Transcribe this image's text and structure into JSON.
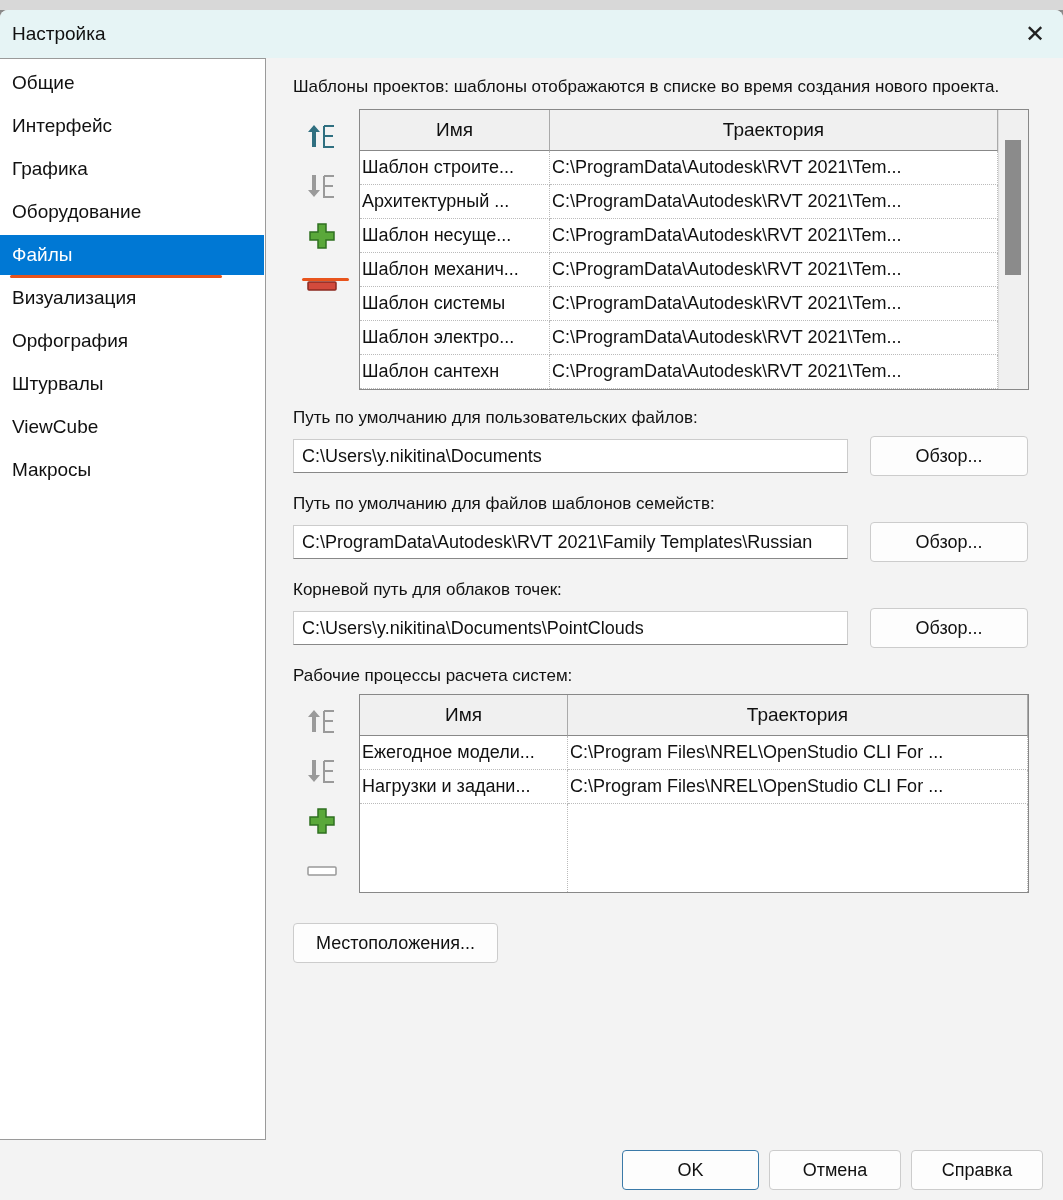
{
  "window": {
    "title": "Настройка",
    "close": "✕"
  },
  "sidebar": {
    "items": [
      {
        "label": "Общие",
        "selected": false
      },
      {
        "label": "Интерфейс",
        "selected": false
      },
      {
        "label": "Графика",
        "selected": false
      },
      {
        "label": "Оборудование",
        "selected": false
      },
      {
        "label": "Файлы",
        "selected": true
      },
      {
        "label": "Визуализация",
        "selected": false
      },
      {
        "label": "Орфография",
        "selected": false
      },
      {
        "label": "Штурвалы",
        "selected": false
      },
      {
        "label": "ViewCube",
        "selected": false
      },
      {
        "label": "Макросы",
        "selected": false
      }
    ]
  },
  "templates": {
    "description": "Шаблоны проектов: шаблоны отображаются в списке во время создания нового проекта.",
    "tools": [
      {
        "kind": "up",
        "disabled": false
      },
      {
        "kind": "down",
        "disabled": true
      },
      {
        "kind": "add",
        "disabled": false
      },
      {
        "kind": "remove",
        "disabled": false
      }
    ],
    "columns": [
      "Имя",
      "Траектория"
    ],
    "rows": [
      [
        "Шаблон строите...",
        "C:\\ProgramData\\Autodesk\\RVT 2021\\Tem..."
      ],
      [
        "Архитектурный ...",
        "C:\\ProgramData\\Autodesk\\RVT 2021\\Tem..."
      ],
      [
        "Шаблон несуще...",
        "C:\\ProgramData\\Autodesk\\RVT 2021\\Tem..."
      ],
      [
        "Шаблон механич...",
        "C:\\ProgramData\\Autodesk\\RVT 2021\\Tem..."
      ],
      [
        "Шаблон системы",
        "C:\\ProgramData\\Autodesk\\RVT 2021\\Tem..."
      ],
      [
        "Шаблон электро...",
        "C:\\ProgramData\\Autodesk\\RVT 2021\\Tem..."
      ],
      [
        "Шаблон сантехн",
        "C:\\ProgramData\\Autodesk\\RVT 2021\\Tem..."
      ]
    ]
  },
  "paths": [
    {
      "label": "Путь по умолчанию для пользовательских файлов:",
      "value": "C:\\Users\\y.nikitina\\Documents",
      "button": "Обзор..."
    },
    {
      "label": "Путь по умолчанию для файлов шаблонов семейств:",
      "value": "C:\\ProgramData\\Autodesk\\RVT 2021\\Family Templates\\Russian",
      "button": "Обзор..."
    },
    {
      "label": "Корневой путь для облаков точек:",
      "value": "C:\\Users\\y.nikitina\\Documents\\PointClouds",
      "button": "Обзор..."
    }
  ],
  "workflows": {
    "label": "Рабочие процессы расчета систем:",
    "tools": [
      {
        "kind": "up",
        "disabled": true
      },
      {
        "kind": "down",
        "disabled": true
      },
      {
        "kind": "add",
        "disabled": false
      },
      {
        "kind": "remove",
        "disabled": true
      }
    ],
    "columns": [
      "Имя",
      "Траектория"
    ],
    "rows": [
      [
        "Ежегодное модели...",
        "C:\\Program Files\\NREL\\OpenStudio CLI For ..."
      ],
      [
        "Нагрузки и задани...",
        "C:\\Program Files\\NREL\\OpenStudio CLI For ..."
      ]
    ]
  },
  "locations_button": "Местоположения...",
  "buttons": [
    {
      "label": "OK",
      "default": true
    },
    {
      "label": "Отмена",
      "default": false
    },
    {
      "label": "Справка",
      "default": false
    }
  ]
}
